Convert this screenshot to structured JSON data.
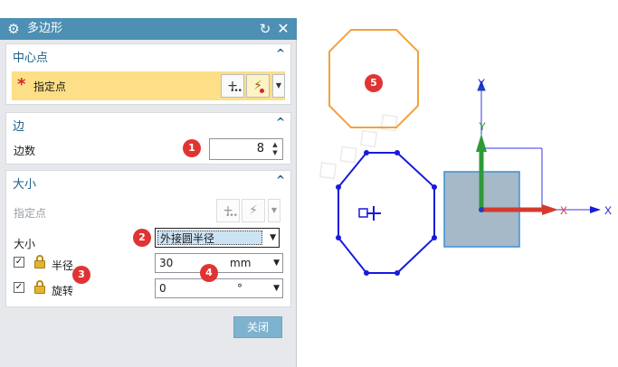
{
  "dialog": {
    "title": "多边形",
    "center": {
      "title": "中心点",
      "toggle": "^",
      "pick_label": "指定点"
    },
    "edge": {
      "title": "边",
      "toggle": "^",
      "edges_label": "边数",
      "edges_value": "8"
    },
    "size": {
      "title": "大小",
      "toggle": "^",
      "point_label": "指定点",
      "size_label": "大小",
      "size_value": "外接圆半径",
      "radius_label": "半径",
      "radius_value": "30",
      "radius_unit": "mm",
      "radius_checked": true,
      "rotation_label": "旋转",
      "rotation_value": "0",
      "rotation_unit": "°",
      "rotation_checked": true
    },
    "close_label": "关闭"
  },
  "markers": [
    "1",
    "2",
    "3",
    "4",
    "5"
  ],
  "canvas": {
    "axis_y_label": "Y",
    "axis_x_label": "X",
    "csys_y_label": "Y",
    "csys_x_label": "X",
    "colors": {
      "octagon": "#1a1adc",
      "preview": "#f2a23c",
      "x_axis": "#d43a2f",
      "y_axis": "#2e9a3a",
      "z_axis": "#1f3fbf",
      "square": "#a5b9c9"
    }
  },
  "icons": [
    "gear-icon",
    "reset-icon",
    "close-icon",
    "point-dialog-icon",
    "point-snap-icon",
    "chevron-down-icon",
    "lock-icon",
    "checkbox-icon"
  ]
}
